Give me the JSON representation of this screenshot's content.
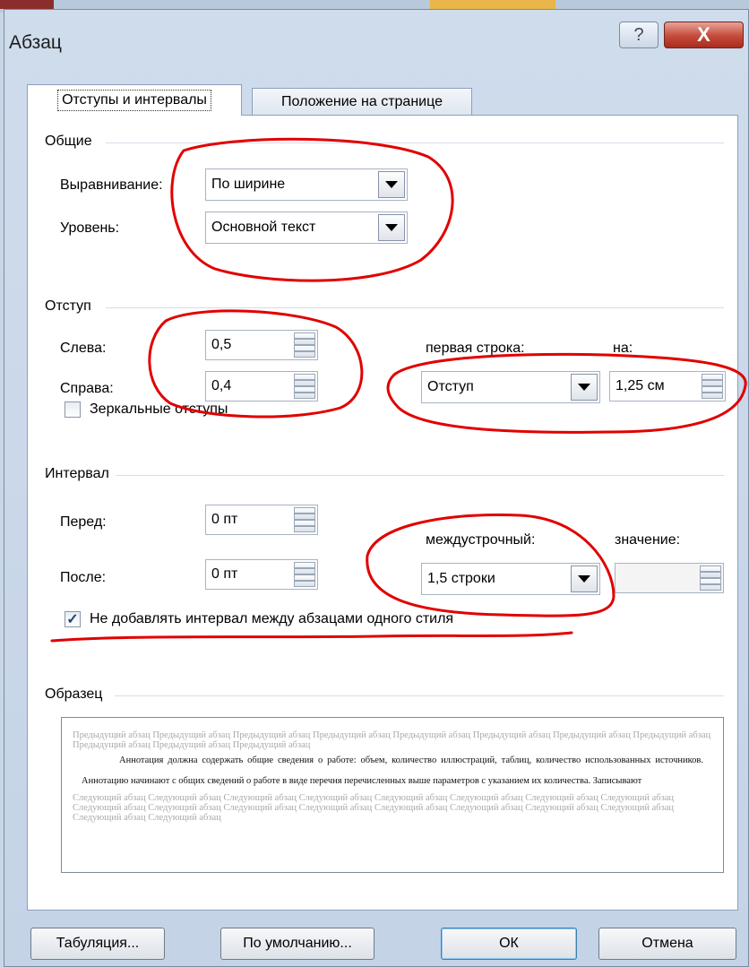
{
  "dialog": {
    "title": "Абзац",
    "help_glyph": "?",
    "close_glyph": "X"
  },
  "tabs": [
    {
      "label": "Отступы и интервалы"
    },
    {
      "label": "Положение на странице"
    }
  ],
  "general": {
    "group_title": "Общие",
    "alignment_label": "Выравнивание:",
    "alignment_value": "По ширине",
    "level_label": "Уровень:",
    "level_value": "Основной текст"
  },
  "indent": {
    "group_title": "Отступ",
    "left_label": "Слева:",
    "left_value": "0,5",
    "right_label": "Справа:",
    "right_value": "0,4",
    "first_line_label": "первая строка:",
    "first_line_value": "Отступ",
    "by_label": "на:",
    "by_value": "1,25 см",
    "mirror_label": "Зеркальные отступы",
    "mirror_checked": false
  },
  "spacing": {
    "group_title": "Интервал",
    "before_label": "Перед:",
    "before_value": "0 пт",
    "after_label": "После:",
    "after_value": "0 пт",
    "line_label": "междустрочный:",
    "line_value": "1,5 строки",
    "at_label": "значение:",
    "at_value": "",
    "dont_add_label": "Не добавлять интервал между абзацами одного стиля",
    "dont_add_checked": true,
    "check_glyph": "✓"
  },
  "preview": {
    "group_title": "Образец",
    "prev_text": "Предыдущий абзац Предыдущий абзац Предыдущий абзац Предыдущий абзац Предыдущий абзац Предыдущий абзац Предыдущий абзац Предыдущий абзац Предыдущий абзац Предыдущий абзац Предыдущий абзац",
    "main_text": "Аннотация должна содержать общие сведения о работе: объем, количество иллюстраций, таблиц, количество использованных источников. Аннотацию начинают с общих сведений о работе в виде перечня перечисленных выше параметров с указанием их количества. Записывают",
    "next_text": "Следующий абзац Следующий абзац Следующий абзац Следующий абзац Следующий абзац Следующий абзац Следующий абзац Следующий абзац Следующий абзац Следующий абзац Следующий абзац Следующий абзац Следующий абзац Следующий абзац Следующий абзац Следующий абзац Следующий абзац Следующий абзац"
  },
  "buttons": {
    "tabs": "Табуляция...",
    "default": "По умолчанию...",
    "ok": "ОК",
    "cancel": "Отмена"
  },
  "colors": {
    "annotation_red": "#e10000",
    "close_red": "#c44a3a",
    "dialog_blue": "#c9d6e6"
  }
}
